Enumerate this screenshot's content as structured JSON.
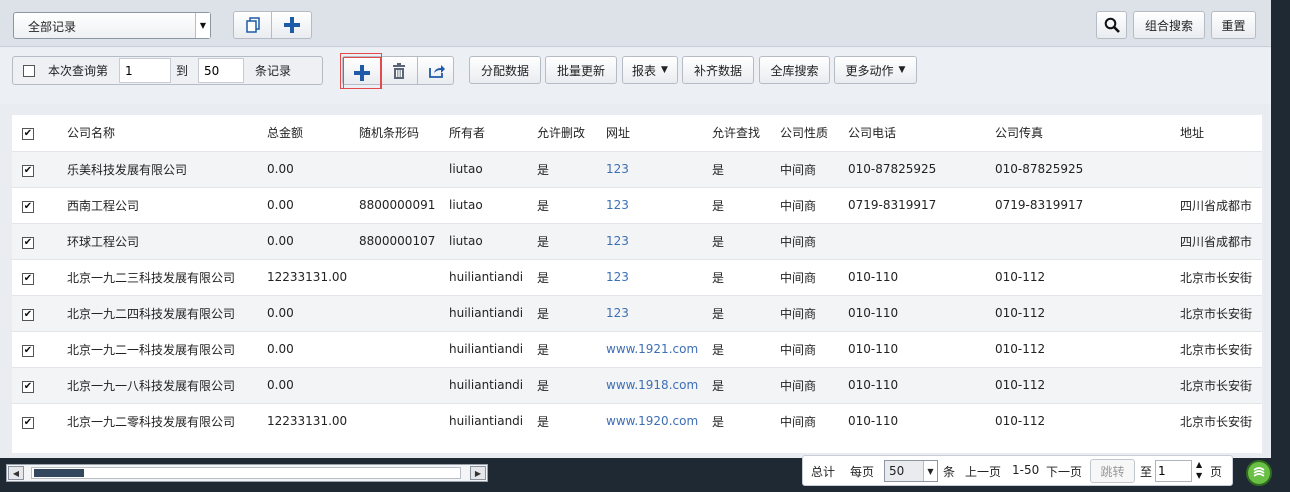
{
  "filter_select": {
    "value": "全部记录"
  },
  "top_right": {
    "search_icon": "search-icon",
    "combo_search": "组合搜索",
    "reset": "重置"
  },
  "range": {
    "label": "本次查询第",
    "from": "1",
    "to_label": "到",
    "to": "50",
    "suffix": "条记录"
  },
  "actions": {
    "assign": "分配数据",
    "batch_update": "批量更新",
    "report": "报表",
    "fill_data": "补齐数据",
    "global_search": "全库搜索",
    "more_actions": "更多动作"
  },
  "columns": [
    "公司名称",
    "总金额",
    "随机条形码",
    "所有者",
    "允许删改",
    "网址",
    "允许查找",
    "公司性质",
    "公司电话",
    "公司传真",
    "地址"
  ],
  "rows": [
    [
      "乐美科技发展有限公司",
      "0.00",
      "",
      "liutao",
      "是",
      "123",
      "是",
      "中间商",
      "010-87825925",
      "010-87825925",
      ""
    ],
    [
      "西南工程公司",
      "0.00",
      "8800000091",
      "liutao",
      "是",
      "123",
      "是",
      "中间商",
      "0719-8319917",
      "0719-8319917",
      "四川省成都市"
    ],
    [
      "环球工程公司",
      "0.00",
      "8800000107",
      "liutao",
      "是",
      "123",
      "是",
      "中间商",
      "",
      "",
      "四川省成都市"
    ],
    [
      "北京一九二三科技发展有限公司",
      "12233131.00",
      "",
      "huiliantiandi",
      "是",
      "123",
      "是",
      "中间商",
      "010-110",
      "010-112",
      "北京市长安街"
    ],
    [
      "北京一九二四科技发展有限公司",
      "0.00",
      "",
      "huiliantiandi",
      "是",
      "123",
      "是",
      "中间商",
      "010-110",
      "010-112",
      "北京市长安街"
    ],
    [
      "北京一九二一科技发展有限公司",
      "0.00",
      "",
      "huiliantiandi",
      "是",
      "www.1921.com",
      "是",
      "中间商",
      "010-110",
      "010-112",
      "北京市长安街"
    ],
    [
      "北京一九一八科技发展有限公司",
      "0.00",
      "",
      "huiliantiandi",
      "是",
      "www.1918.com",
      "是",
      "中间商",
      "010-110",
      "010-112",
      "北京市长安街"
    ],
    [
      "北京一九二零科技发展有限公司",
      "12233131.00",
      "",
      "huiliantiandi",
      "是",
      "www.1920.com",
      "是",
      "中间商",
      "010-110",
      "010-112",
      "北京市长安街"
    ]
  ],
  "pager": {
    "total": "总计",
    "per_page": "每页",
    "page_size": "50",
    "unit": "条",
    "prev": "上一页",
    "range": "1-50",
    "next": "下一页",
    "jump": "跳转",
    "to": "至",
    "page_value": "1",
    "page_unit": "页"
  },
  "colors": {
    "link": "#3d6fb5",
    "add_icon": "#1e5aa8",
    "highlight_border": "#e24b4b"
  }
}
